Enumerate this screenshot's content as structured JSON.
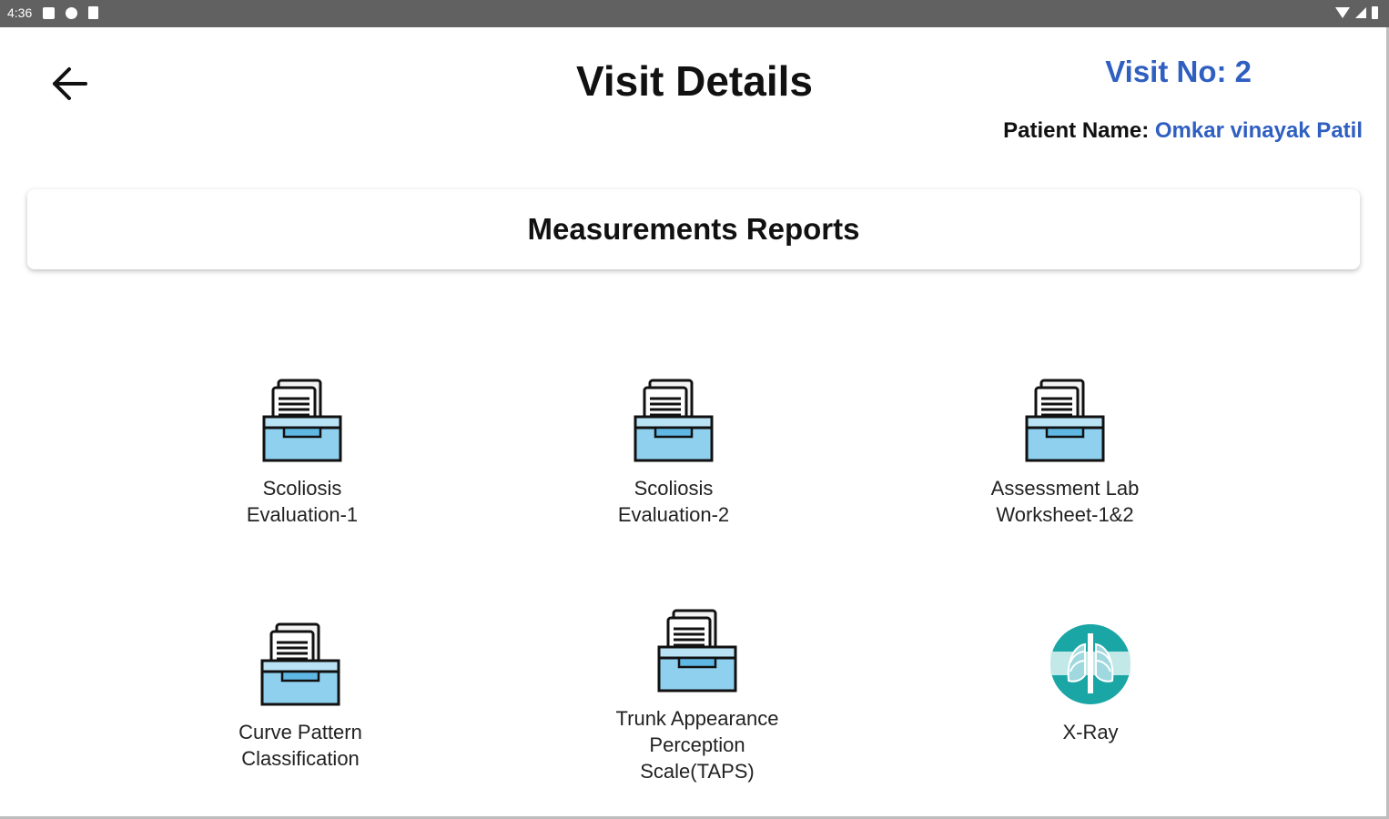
{
  "status_bar": {
    "time": "4:36",
    "icons": [
      "notification-icon",
      "sync-icon",
      "sd-card-icon"
    ],
    "right_icons": [
      "wifi-icon",
      "signal-icon",
      "battery-icon"
    ]
  },
  "header": {
    "back_icon": "arrow-left-icon",
    "title": "Visit Details",
    "visit_no": "Visit No: 2",
    "patient_label": "Patient Name:",
    "patient_name": "Omkar vinayak Patil"
  },
  "section": {
    "title": "Measurements Reports"
  },
  "tiles": [
    {
      "label": "Scoliosis\nEvaluation-1",
      "icon": "file-cabinet-icon"
    },
    {
      "label": "Scoliosis\nEvaluation-2",
      "icon": "file-cabinet-icon"
    },
    {
      "label": "Assessment Lab\nWorksheet-1&2",
      "icon": "file-cabinet-icon"
    },
    {
      "label": "Curve Pattern\nClassification",
      "icon": "file-cabinet-icon"
    },
    {
      "label": "Trunk Appearance\nPerception\nScale(TAPS)",
      "icon": "file-cabinet-icon"
    },
    {
      "label": "X-Ray",
      "icon": "xray-chest-icon"
    }
  ],
  "colors": {
    "accent_blue": "#2f5fc0",
    "tray_blue": "#8fd0ef",
    "xray_teal": "#1ba6a6",
    "status_bar": "#616161"
  }
}
